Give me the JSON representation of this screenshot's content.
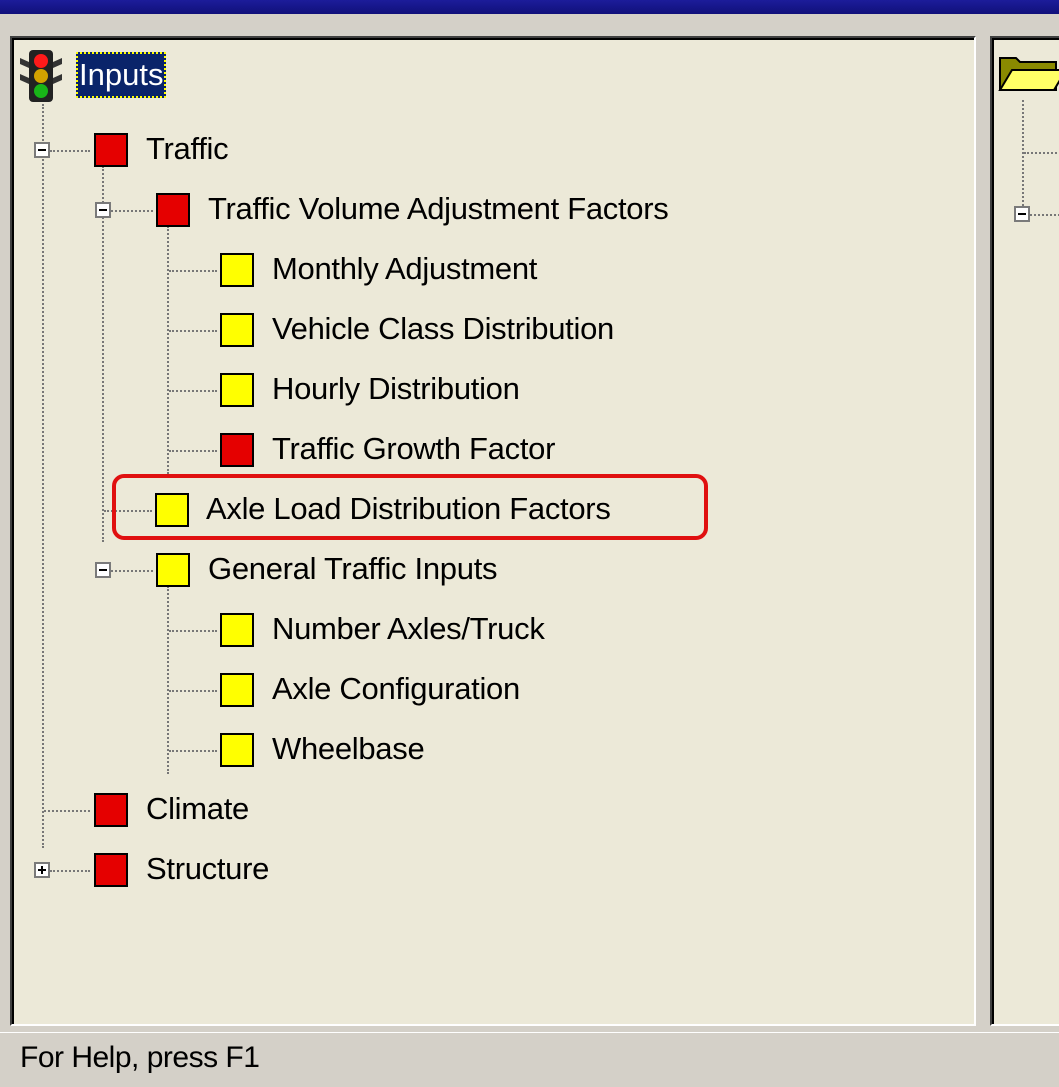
{
  "tree": {
    "root_label": "Inputs",
    "items": [
      {
        "label": "Traffic",
        "status_color": "#e50000"
      },
      {
        "label": "Traffic Volume Adjustment Factors",
        "status_color": "#e50000"
      },
      {
        "label": "Monthly Adjustment",
        "status_color": "#ffff00"
      },
      {
        "label": "Vehicle Class Distribution",
        "status_color": "#ffff00"
      },
      {
        "label": "Hourly Distribution",
        "status_color": "#ffff00"
      },
      {
        "label": "Traffic Growth Factor",
        "status_color": "#e50000"
      },
      {
        "label": "Axle Load Distribution Factors",
        "status_color": "#ffff00",
        "highlighted": true
      },
      {
        "label": "General Traffic Inputs",
        "status_color": "#ffff00"
      },
      {
        "label": "Number Axles/Truck",
        "status_color": "#ffff00"
      },
      {
        "label": "Axle Configuration",
        "status_color": "#ffff00"
      },
      {
        "label": "Wheelbase",
        "status_color": "#ffff00"
      },
      {
        "label": "Climate",
        "status_color": "#e50000"
      },
      {
        "label": "Structure",
        "status_color": "#e50000"
      }
    ]
  },
  "statusbar": {
    "text": "For Help, press F1"
  },
  "colors": {
    "highlight": "#e01010",
    "selection": "#0a246a"
  }
}
